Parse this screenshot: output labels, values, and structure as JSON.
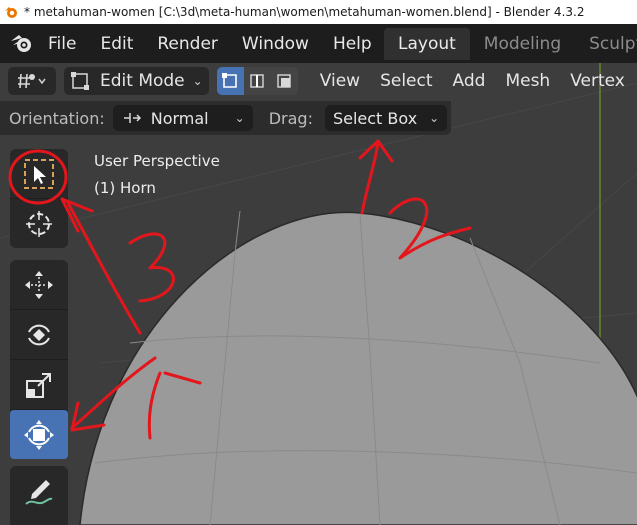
{
  "window": {
    "title": "* metahuman-women [C:\\3d\\meta-human\\women\\metahuman-women.blend] - Blender 4.3.2"
  },
  "menubar": {
    "items": [
      "File",
      "Edit",
      "Render",
      "Window",
      "Help"
    ],
    "workspaces": [
      "Layout",
      "Modeling",
      "Sculptin"
    ],
    "active_workspace": "Layout"
  },
  "viewport_header": {
    "mode": "Edit Mode",
    "select_modes": [
      "vertex",
      "edge",
      "face"
    ],
    "active_select_mode": "vertex",
    "menus": [
      "View",
      "Select",
      "Add",
      "Mesh",
      "Vertex"
    ]
  },
  "tool_settings": {
    "orientation_label": "Orientation:",
    "orientation_value": "Normal",
    "drag_label": "Drag:",
    "drag_value": "Select Box"
  },
  "viewport": {
    "view_name": "User Perspective",
    "object_name": "(1) Horn"
  },
  "toolbar": {
    "tools": [
      {
        "name": "select-box",
        "icon": "select-box-icon",
        "active": false
      },
      {
        "name": "cursor",
        "icon": "cursor-icon",
        "active": false
      },
      {
        "name": "move",
        "icon": "move-icon",
        "active": false
      },
      {
        "name": "rotate",
        "icon": "rotate-icon",
        "active": false
      },
      {
        "name": "scale",
        "icon": "scale-icon",
        "active": false
      },
      {
        "name": "transform",
        "icon": "transform-icon",
        "active": true
      },
      {
        "name": "annotate",
        "icon": "annotate-icon",
        "active": false
      }
    ]
  },
  "annotations": {
    "color": "#e3161c",
    "labels": [
      "1",
      "2",
      "3"
    ]
  },
  "colors": {
    "accent": "#4772b3",
    "viewport_bg": "#3d3d3d",
    "mesh": "#969696"
  }
}
